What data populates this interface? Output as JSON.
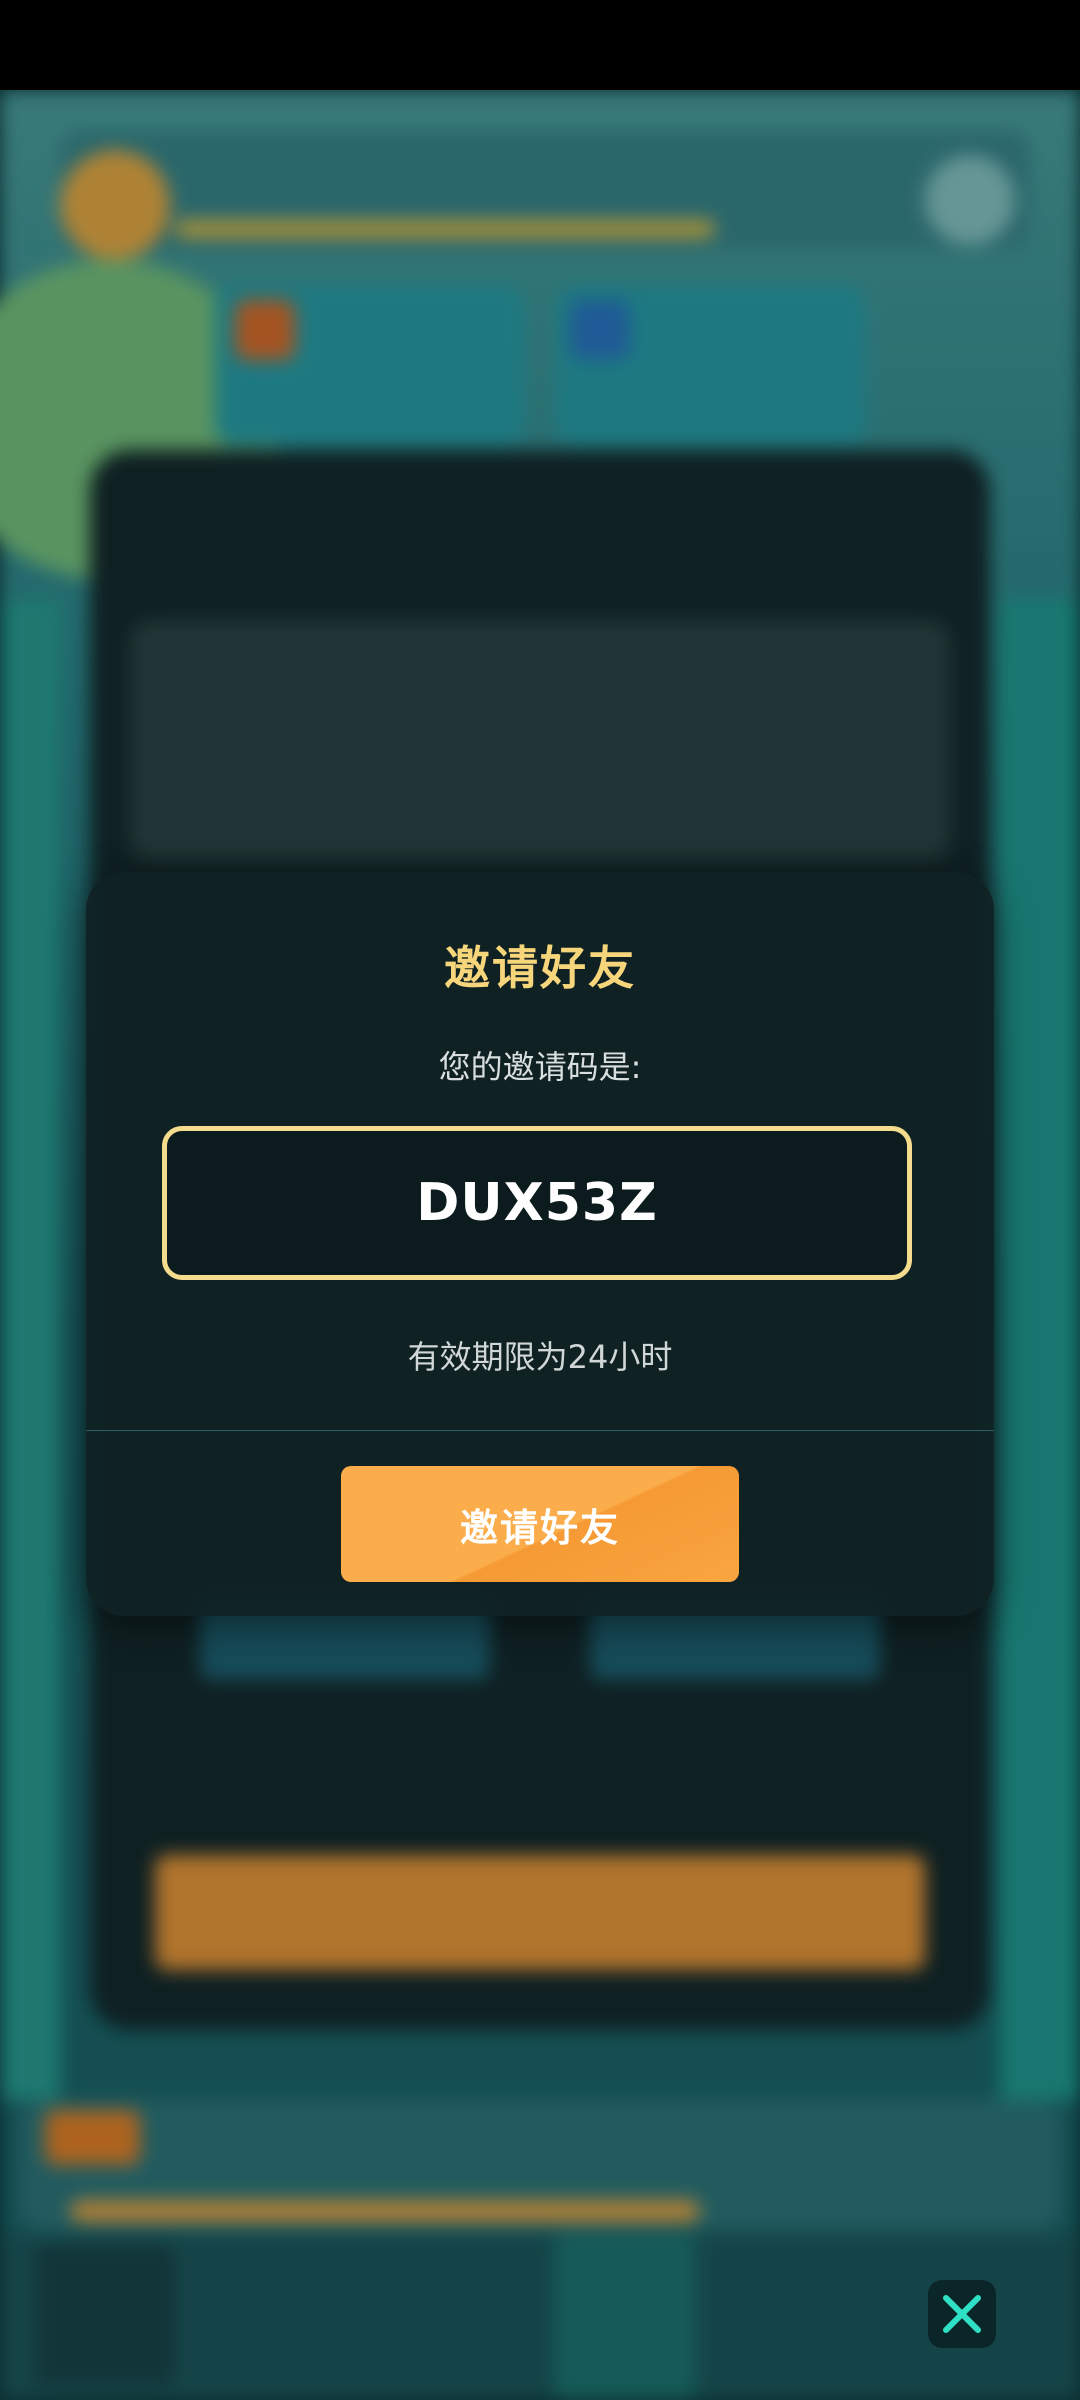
{
  "modal": {
    "title": "邀请好友",
    "code_label": "您的邀请码是:",
    "code": "DUX53Z",
    "validity": "有效期限为24小时",
    "button_label": "邀请好友"
  },
  "controls": {
    "close_icon": "close-icon"
  },
  "colors": {
    "title": "#f7d57a",
    "code_border": "#f4dc8c",
    "button": "#fbad4b",
    "close_x": "#2fe0c4"
  }
}
